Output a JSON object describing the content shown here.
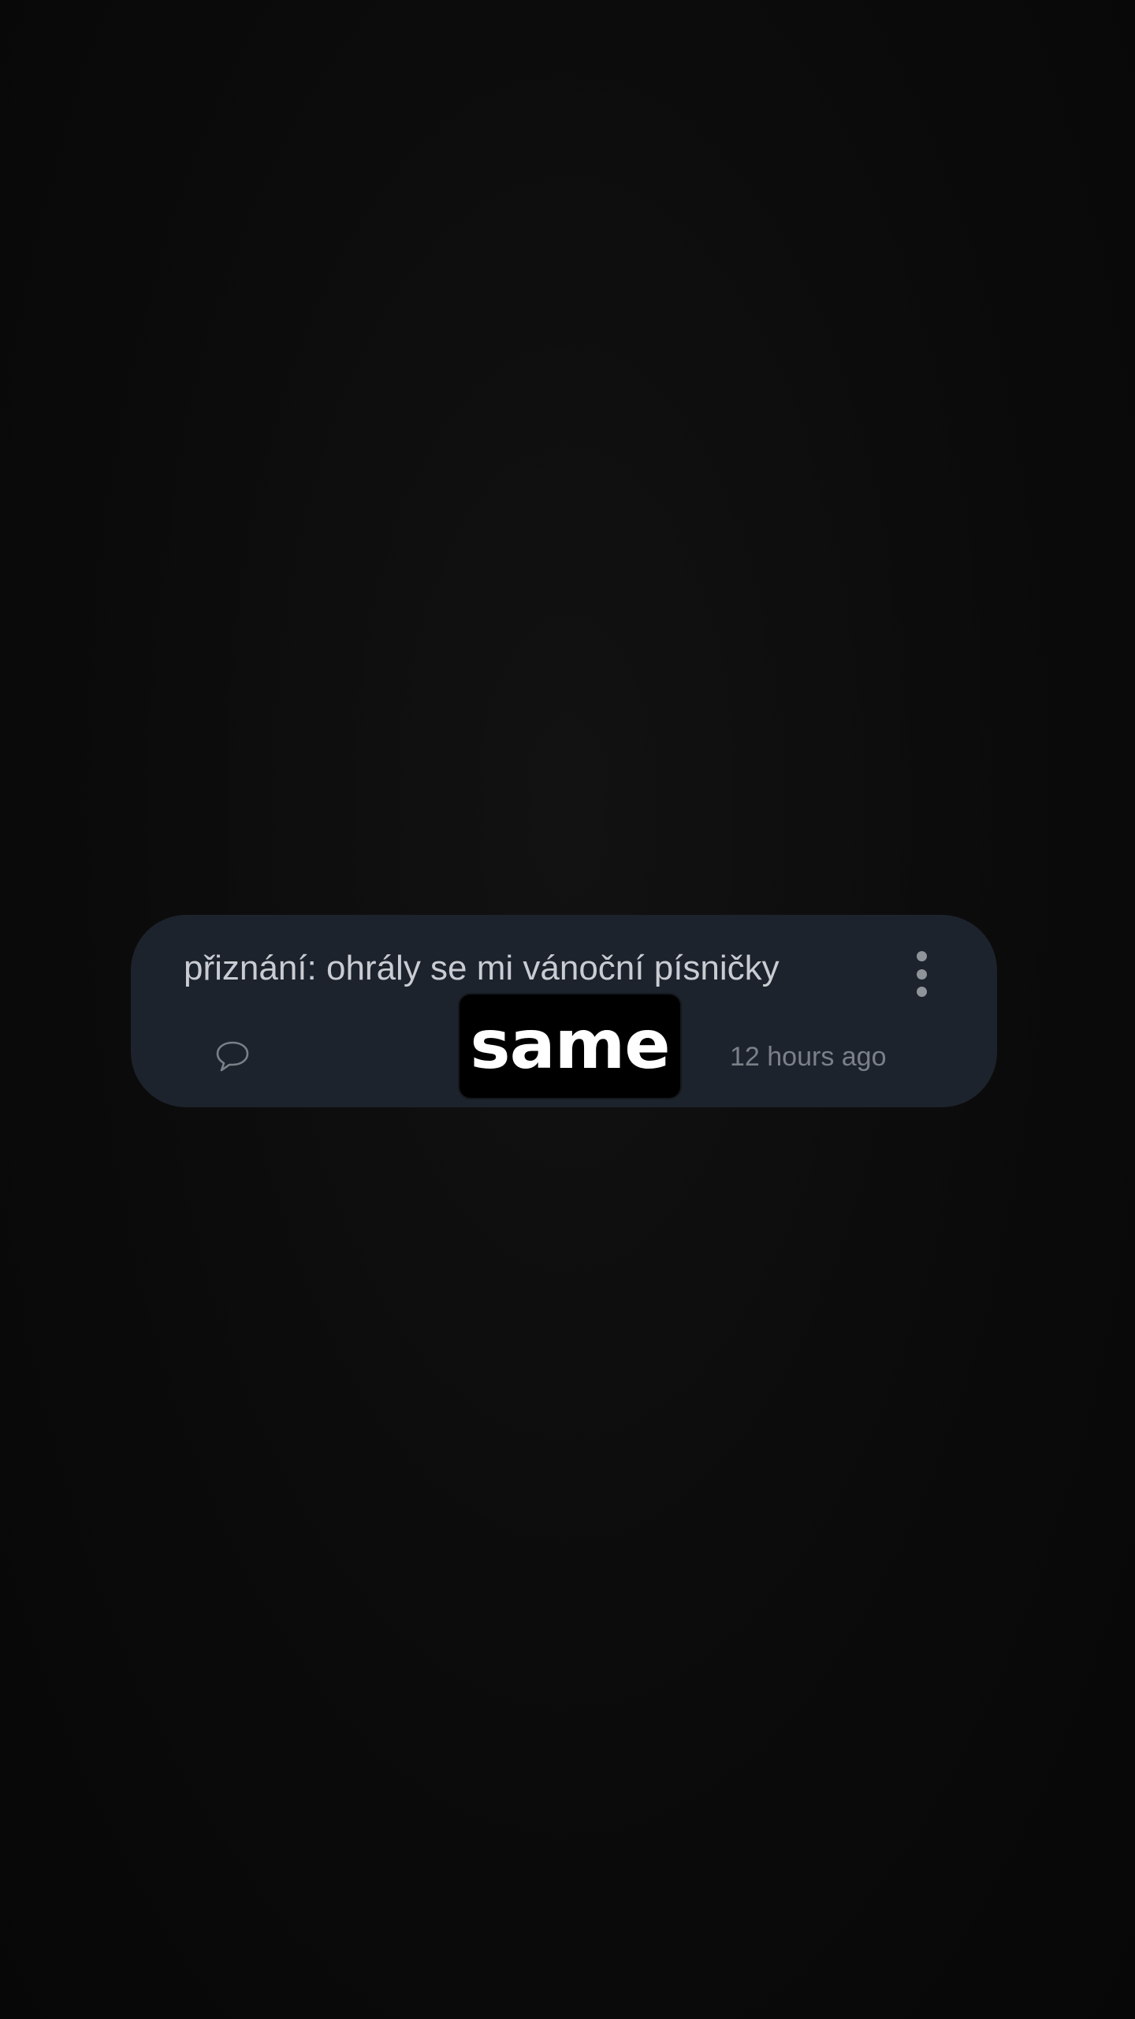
{
  "post": {
    "text": "přiznání: ohrály se mi vánoční písničky",
    "timestamp": "12 hours ago",
    "menu_icon": "more-vertical-icon",
    "comment_icon": "speech-bubble-icon"
  },
  "sticker": {
    "text": "same"
  },
  "colors": {
    "background": "#0b0b0b",
    "card": "#1d232c",
    "text": "#c9ccd2",
    "muted": "#7b8088",
    "sticker_bg": "#000000",
    "sticker_text": "#ffffff"
  }
}
